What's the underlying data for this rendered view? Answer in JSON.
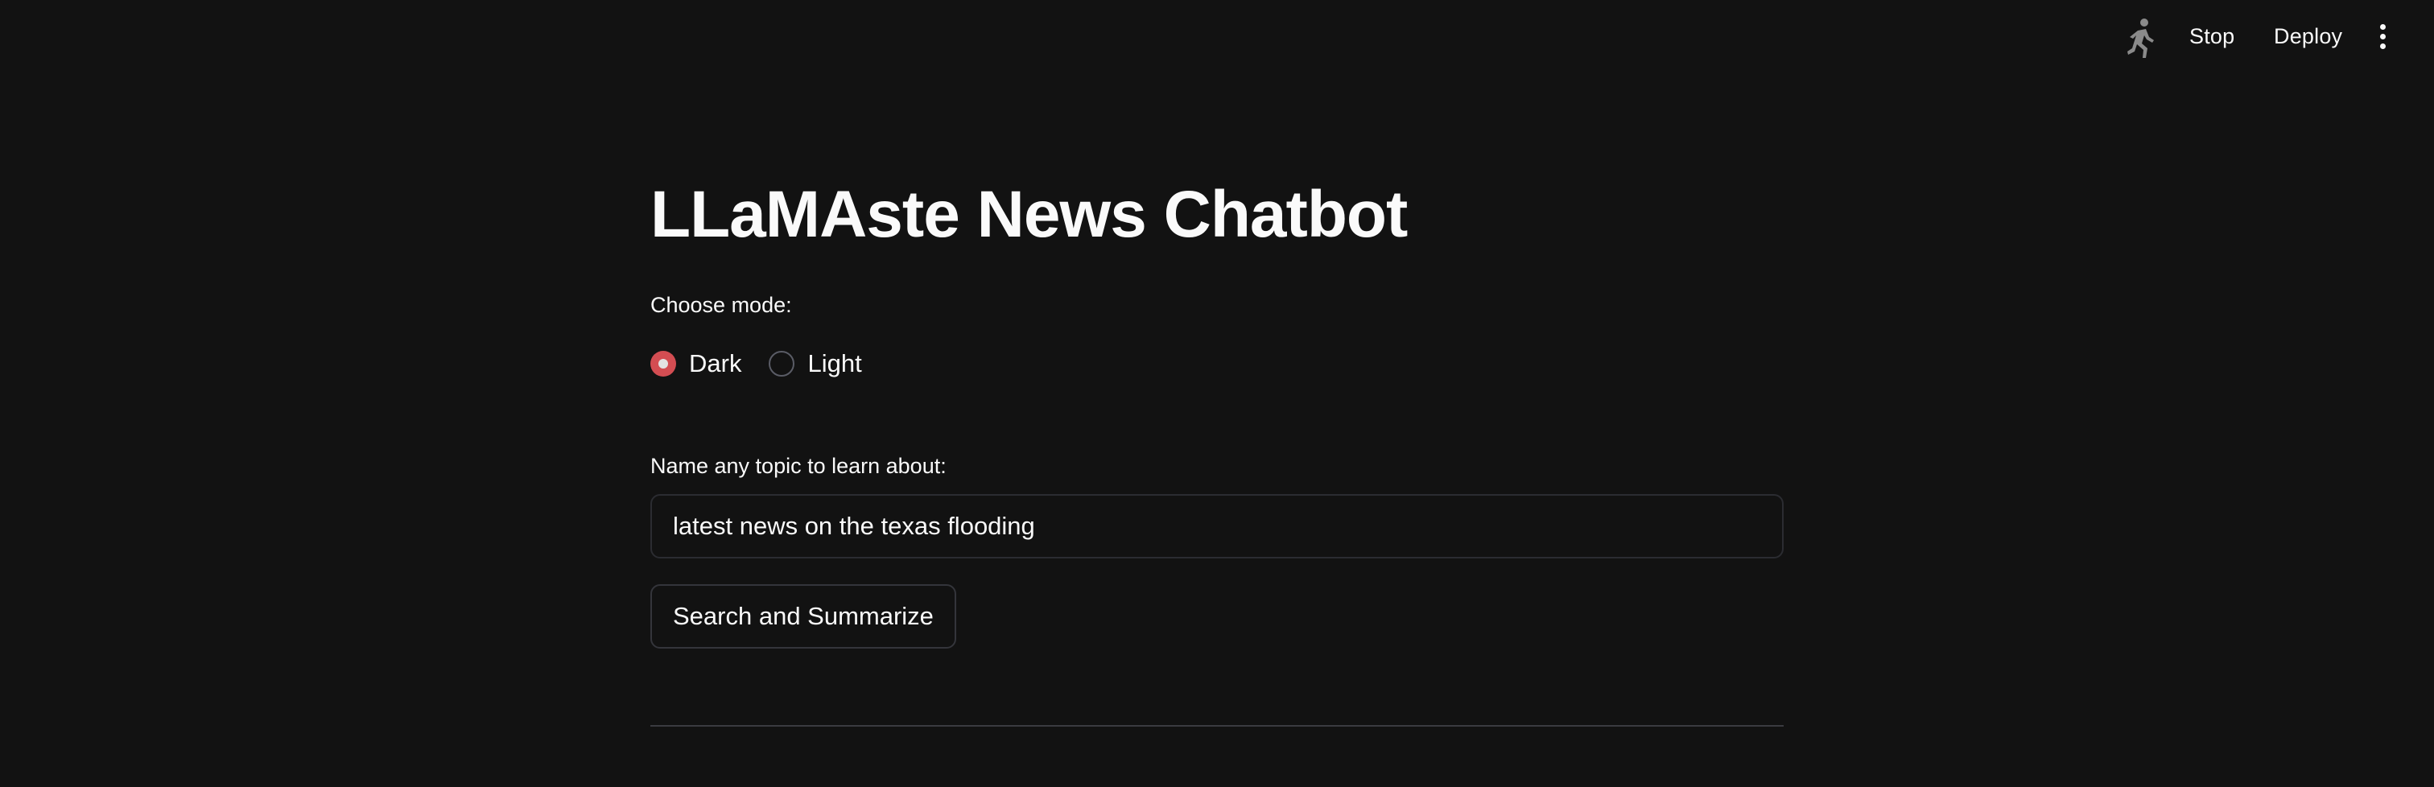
{
  "toolbar": {
    "running_icon": "running-person-icon",
    "stop_label": "Stop",
    "deploy_label": "Deploy",
    "menu_icon": "vertical-dots-icon"
  },
  "main": {
    "title": "LLaMAste News Chatbot",
    "mode": {
      "label": "Choose mode:",
      "options": [
        {
          "label": "Dark",
          "selected": true
        },
        {
          "label": "Light",
          "selected": false
        }
      ]
    },
    "topic": {
      "label": "Name any topic to learn about:",
      "value": "latest news on the texas flooding"
    },
    "search_button_label": "Search and Summarize"
  },
  "colors": {
    "background": "#121212",
    "accent": "#e8545a",
    "text": "#fafafa"
  }
}
